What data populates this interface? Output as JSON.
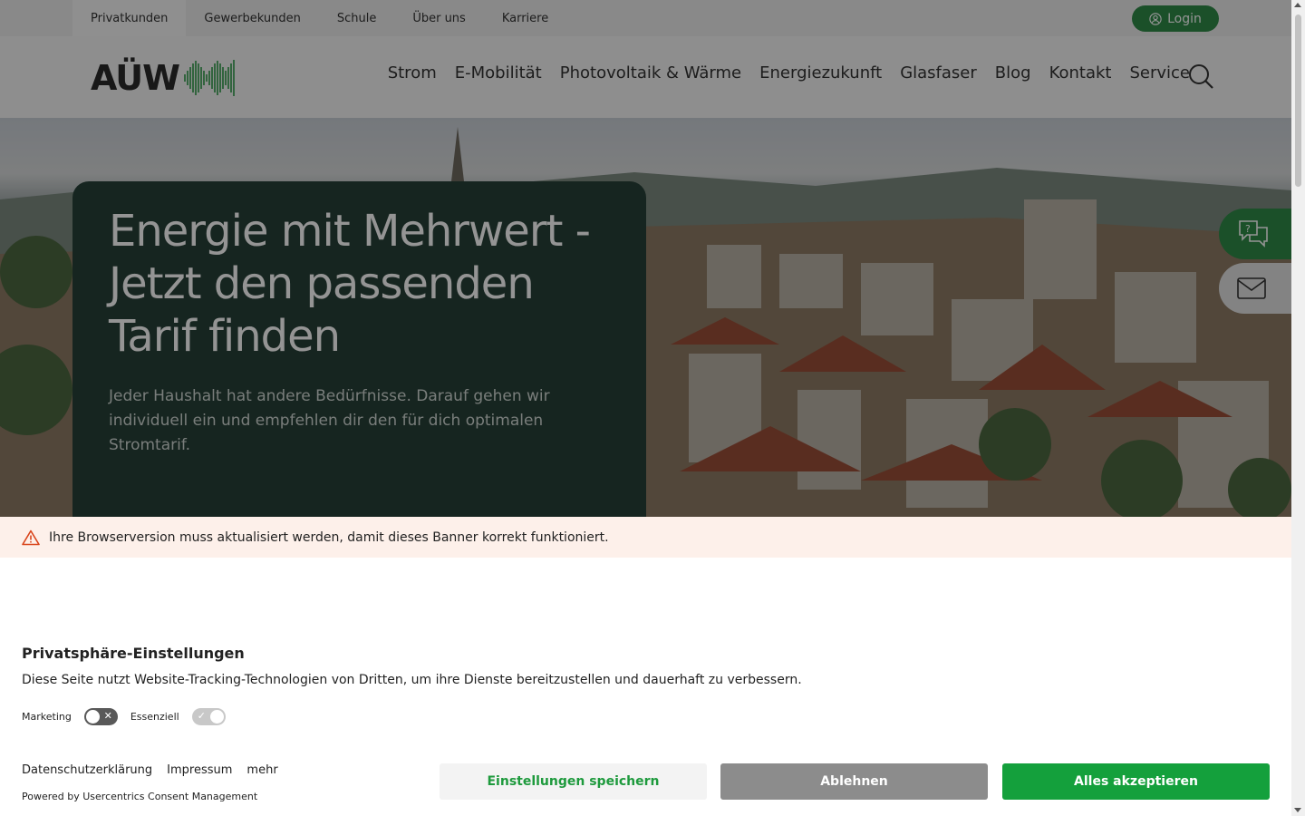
{
  "topbar": {
    "tabs": [
      {
        "label": "Privatkunden",
        "active": true
      },
      {
        "label": "Gewerbekunden"
      },
      {
        "label": "Schule"
      },
      {
        "label": "Über uns"
      },
      {
        "label": "Karriere"
      }
    ],
    "login_label": "Login"
  },
  "header": {
    "logo_text": "AÜW",
    "nav": [
      "Strom",
      "E-Mobilität",
      "Photovoltaik & Wärme",
      "Energiezukunft",
      "Glasfaser",
      "Blog",
      "Kontakt",
      "Service"
    ]
  },
  "hero": {
    "title": "Energie mit Mehrwert - Jetzt den passenden Tarif finden",
    "text": "Jeder Haushalt hat andere Bedürfnisse. Darauf gehen wir individuell ein und empfehlen dir den für dich optimalen Stromtarif."
  },
  "consent": {
    "warning": "Ihre Browserversion muss aktualisiert werden, damit dieses Banner korrekt funktioniert.",
    "title": "Privatsphäre-Einstellungen",
    "description": "Diese Seite nutzt Website-Tracking-Technologien von Dritten, um ihre Dienste bereitzustellen und dauerhaft zu verbessern.",
    "toggles": [
      {
        "label": "Marketing",
        "state": "off"
      },
      {
        "label": "Essenziell",
        "state": "on"
      }
    ],
    "links": [
      "Datenschutzerklärung",
      "Impressum",
      "mehr"
    ],
    "powered_by": "Powered by Usercentrics Consent Management",
    "buttons": {
      "save": "Einstellungen speichern",
      "deny": "Ablehnen",
      "accept": "Alles akzeptieren"
    }
  },
  "colors": {
    "brand_green": "#2f8a48",
    "hero_card": "#274037",
    "accept_green": "#14a03c",
    "deny_gray": "#8c8c8c"
  }
}
